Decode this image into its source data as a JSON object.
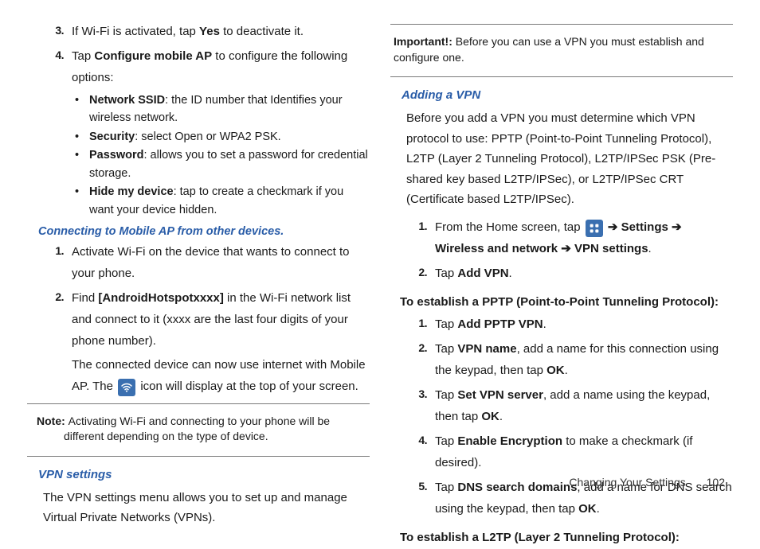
{
  "left": {
    "step3_num": "3.",
    "step3_a": "If Wi-Fi is activated, tap ",
    "step3_b": "Yes",
    "step3_c": " to deactivate it.",
    "step4_num": "4.",
    "step4_a": "Tap ",
    "step4_b": "Configure mobile AP",
    "step4_c": " to configure the following options:",
    "bul1_a": "Network SSID",
    "bul1_b": ": the ID number that Identifies your wireless network.",
    "bul2_a": "Security",
    "bul2_b": ": select Open or WPA2 PSK.",
    "bul3_a": "Password",
    "bul3_b": ": allows you to set a password for credential storage.",
    "bul4_a": "Hide my device",
    "bul4_b": ": tap to create a checkmark if you want your device hidden.",
    "h_connect": "Connecting to Mobile AP from other devices.",
    "c1_num": "1.",
    "c1": "Activate Wi-Fi on the device that wants to connect to your phone.",
    "c2_num": "2.",
    "c2_a": "Find ",
    "c2_b": "[AndroidHotspotxxxx]",
    "c2_c": " in the Wi-Fi network list and connect to it (xxxx are the last four digits of your phone number).",
    "c2_p2_a": "The connected device can now use internet with Mobile AP. The ",
    "c2_p2_b": " icon will display at the top of your screen.",
    "note_lbl": "Note: ",
    "note_txt": "Activating Wi-Fi and connecting to your phone will be different depending on the type of device.",
    "h_vpn": "VPN settings",
    "vpn_para": "The VPN settings menu allows you to set up and manage Virtual Private Networks (VPNs)."
  },
  "right": {
    "imp_lbl": "Important!: ",
    "imp_txt": "Before you can use a VPN you must establish and configure one.",
    "h_add": "Adding a VPN",
    "add_para": "Before you add a VPN you must determine which VPN protocol to use: PPTP (Point-to-Point Tunneling Protocol), L2TP (Layer 2 Tunneling Protocol), L2TP/IPSec PSK (Pre-shared key based L2TP/IPSec), or L2TP/IPSec CRT (Certificate based L2TP/IPSec).",
    "a1_num": "1.",
    "a1_a": "From the Home screen, tap ",
    "a1_b": "Settings",
    "a1_c": "Wireless and network",
    "a1_d": "VPN settings",
    "arrow": "➔",
    "a2_num": "2.",
    "a2_a": "Tap ",
    "a2_b": "Add VPN",
    "h_pptp": "To establish a PPTP (Point-to-Point Tunneling Protocol):",
    "p1_num": "1.",
    "p1_a": "Tap ",
    "p1_b": "Add PPTP VPN",
    "p2_num": "2.",
    "p2_a": "Tap ",
    "p2_b": "VPN name",
    "p2_c": ", add a name for this connection using the keypad, then tap ",
    "p2_d": "OK",
    "p3_num": "3.",
    "p3_a": "Tap ",
    "p3_b": "Set VPN server",
    "p3_c": ", add a name using the keypad, then tap ",
    "p3_d": "OK",
    "p4_num": "4.",
    "p4_a": "Tap ",
    "p4_b": "Enable Encryption",
    "p4_c": " to make a checkmark (if desired).",
    "p5_num": "5.",
    "p5_a": "Tap ",
    "p5_b": "DNS search domains",
    "p5_c": ", add a name for DNS search using the keypad, then tap ",
    "p5_d": "OK",
    "h_l2tp": "To establish a L2TP (Layer 2 Tunneling Protocol):"
  },
  "footer": {
    "section": "Changing Your Settings",
    "page": "102"
  }
}
